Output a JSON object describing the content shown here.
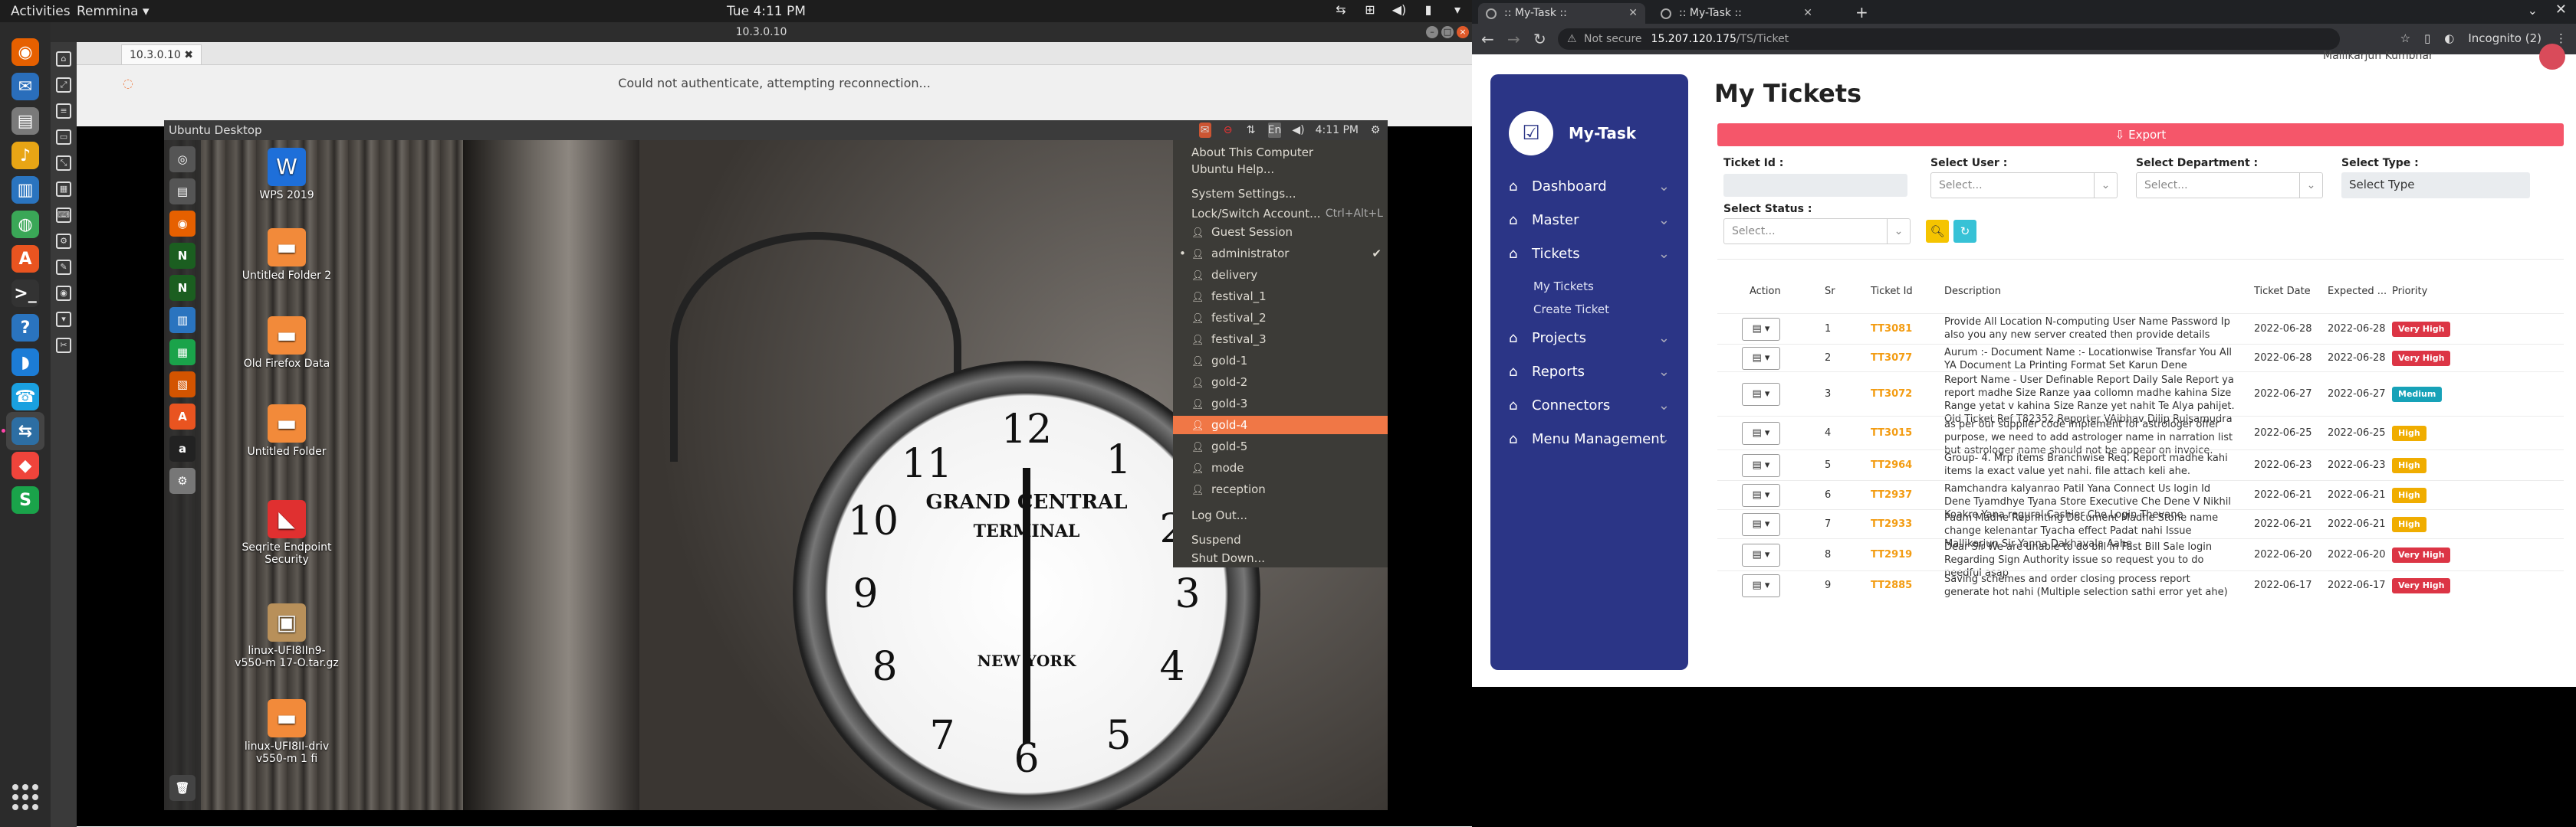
{
  "gnome": {
    "activities": "Activities",
    "app_menu": "Remmina ▾",
    "clock": "Tue  4:11 PM",
    "dock": [
      {
        "icon": "firefox-icon",
        "glyph": "◉",
        "color": "#e66000"
      },
      {
        "icon": "thunderbird-icon",
        "glyph": "✉",
        "color": "#2a6ebb"
      },
      {
        "icon": "files-icon",
        "glyph": "▤",
        "color": "#7a7a7a"
      },
      {
        "icon": "rhythmbox-icon",
        "glyph": "♪",
        "color": "#e8a515"
      },
      {
        "icon": "writer-icon",
        "glyph": "▥",
        "color": "#2a74bf"
      },
      {
        "icon": "chrome-icon",
        "glyph": "◍",
        "color": "#3aa757"
      },
      {
        "icon": "software-icon",
        "glyph": "A",
        "color": "#e95420"
      },
      {
        "icon": "terminal-icon",
        "glyph": ">_",
        "color": "#333333"
      },
      {
        "icon": "help-icon",
        "glyph": "?",
        "color": "#2a74bf"
      },
      {
        "icon": "remote-dolphin-icon",
        "glyph": "◗",
        "color": "#1c7cd6"
      },
      {
        "icon": "phone-icon",
        "glyph": "☎",
        "color": "#1aa0e0"
      },
      {
        "icon": "remmina-icon",
        "glyph": "⇆",
        "color": "#2d6ea3"
      },
      {
        "icon": "anydesk-icon",
        "glyph": "◆",
        "color": "#ef443b"
      },
      {
        "icon": "sheets-icon",
        "glyph": "S",
        "color": "#1aa34a"
      }
    ]
  },
  "remmina": {
    "window_title": "10.3.0.10",
    "tab_label": "10.3.0.10 ✖",
    "status": "Could not authenticate, attempting reconnection..."
  },
  "ubuntu": {
    "title": "Ubuntu Desktop",
    "panel_time": "4:11 PM",
    "desktop_icons": [
      {
        "label": "WPS 2019",
        "glyph": "W",
        "color": "#1e6fd9"
      },
      {
        "label": "Untitled Folder 2",
        "glyph": "▬",
        "color": "#f28a3a"
      },
      {
        "label": "Old Firefox Data",
        "glyph": "▬",
        "color": "#f28a3a"
      },
      {
        "label": "Untitled Folder",
        "glyph": "▬",
        "color": "#f28a3a"
      },
      {
        "label": "Seqrite Endpoint Security",
        "glyph": "◣",
        "color": "#e03030"
      },
      {
        "label": "linux-UFI8IIn9-v550-m 17-O.tar.gz",
        "glyph": "▣",
        "color": "#b8905a"
      },
      {
        "label": "linux-UFI8II-driv v550-m 1 fi",
        "glyph": "▬",
        "color": "#f28a3a"
      }
    ],
    "menu": [
      {
        "label": "About This Computer",
        "kind": "item"
      },
      {
        "label": "Ubuntu Help...",
        "kind": "item"
      },
      {
        "label": "System Settings...",
        "kind": "item"
      },
      {
        "label": "Lock/Switch Account...",
        "kind": "item",
        "shortcut": "Ctrl+Alt+L"
      },
      {
        "label": "Guest Session",
        "kind": "user"
      },
      {
        "label": "administrator",
        "kind": "user",
        "current": true
      },
      {
        "label": "delivery",
        "kind": "user"
      },
      {
        "label": "festival_1",
        "kind": "user"
      },
      {
        "label": "festival_2",
        "kind": "user"
      },
      {
        "label": "festival_3",
        "kind": "user"
      },
      {
        "label": "gold-1",
        "kind": "user"
      },
      {
        "label": "gold-2",
        "kind": "user"
      },
      {
        "label": "gold-3",
        "kind": "user"
      },
      {
        "label": "gold-4",
        "kind": "user",
        "selected": true
      },
      {
        "label": "gold-5",
        "kind": "user"
      },
      {
        "label": "mode",
        "kind": "user"
      },
      {
        "label": "reception",
        "kind": "user"
      },
      {
        "label": "Log Out...",
        "kind": "item"
      },
      {
        "label": "Suspend",
        "kind": "item"
      },
      {
        "label": "Shut Down...",
        "kind": "item"
      }
    ]
  },
  "chrome": {
    "tabs": [
      ":: My-Task ::",
      ":: My-Task ::"
    ],
    "not_secure": "Not secure",
    "url_host": "15.207.120.175",
    "url_path": "/TS/Ticket",
    "profile": "Incognito (2)"
  },
  "app": {
    "brand": "My-Task",
    "nav": [
      {
        "label": "Dashboard"
      },
      {
        "label": "Master"
      },
      {
        "label": "Tickets"
      },
      {
        "label": "Projects"
      },
      {
        "label": "Reports"
      },
      {
        "label": "Connectors"
      },
      {
        "label": "Menu Management"
      }
    ],
    "ticket_sub": [
      "My Tickets",
      "Create Ticket"
    ],
    "page_title": "My Tickets",
    "user_name": "Mallikarjun Kumbhar",
    "export_label": "⇩ Export",
    "filters": {
      "ticket_id_label": "Ticket Id :",
      "user_label": "Select User :",
      "dept_label": "Select Department :",
      "type_label": "Select Type :",
      "status_label": "Select Status :",
      "placeholder": "Select...",
      "type_value": "Select Type"
    },
    "columns": [
      "Action",
      "Sr",
      "Ticket Id",
      "Description",
      "Ticket Date",
      "Expected ...",
      "Priority"
    ],
    "priority_colors": {
      "Very High": "#dc3545",
      "Medium": "#17a2b8",
      "High": "#f0ad00"
    },
    "rows": [
      {
        "sr": "1",
        "id": "TT3081",
        "desc": "Provide All Location N-computing User Name Password Ip also you any new server created then provide details",
        "date": "2022-06-28",
        "expected": "2022-06-28",
        "priority": "Very High"
      },
      {
        "sr": "2",
        "id": "TT3077",
        "desc": "Aurum :- Document Name :- Locationwise Transfar You All YA Document La Printing Format Set Karun Dene",
        "date": "2022-06-28",
        "expected": "2022-06-28",
        "priority": "Very High"
      },
      {
        "sr": "3",
        "id": "TT3072",
        "desc": "Report Name - User Definable Report Daily Sale Report ya report madhe Size Ranze yaa collomn madhe kahina Size Range yetat v kahina Size Ranze yet nahit Te Alya pahijet. Old Ticket Ref T82352 Reporter VAibhav Dilip Rulsamudra",
        "date": "2022-06-27",
        "expected": "2022-06-27",
        "priority": "Medium"
      },
      {
        "sr": "4",
        "id": "TT3015",
        "desc": "as per our supplier code implement for astrologer offer purpose, we need to add astrologer name in narration list but astrologer name should not be appear on invoice.",
        "date": "2022-06-25",
        "expected": "2022-06-25",
        "priority": "High"
      },
      {
        "sr": "5",
        "id": "TT2964",
        "desc": "Group- 4. Mrp items Branchwise Req. Report madhe kahi items la exact value yet nahi. file attach keli ahe.",
        "date": "2022-06-23",
        "expected": "2022-06-23",
        "priority": "High"
      },
      {
        "sr": "6",
        "id": "TT2937",
        "desc": "Ramchandra kalyanrao Patil Yana Connect Us login Id Dene Tyamdhye Tyana Store Executive Che Dene V Nikhil Koakre Yana regural Cashier Che Login Thevane",
        "date": "2022-06-21",
        "expected": "2022-06-21",
        "priority": "High"
      },
      {
        "sr": "7",
        "id": "TT2933",
        "desc": "Padm Madhe Reprinting Document Madhe Stone name change kelenantar Tyacha effect Padat nahi Issue Mallikarjun Sir Yanna Dakhavala Aahe",
        "date": "2022-06-21",
        "expected": "2022-06-21",
        "priority": "High"
      },
      {
        "sr": "8",
        "id": "TT2919",
        "desc": "Dear Sir We are unable to do bill in Fast Bill Sale login Regarding Sign Authority issue so request you to do needful asap",
        "date": "2022-06-20",
        "expected": "2022-06-20",
        "priority": "Very High"
      },
      {
        "sr": "9",
        "id": "TT2885",
        "desc": "Saving schemes and order closing process report generate hot nahi (Multiple selection sathi error yet ahe)",
        "date": "2022-06-17",
        "expected": "2022-06-17",
        "priority": "Very High"
      }
    ]
  }
}
